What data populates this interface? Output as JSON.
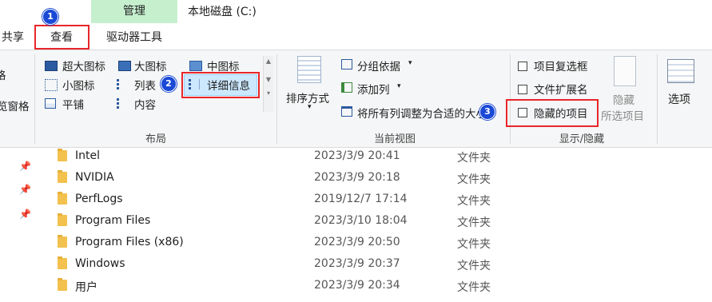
{
  "window": {
    "title": "本地磁盘 (C:)"
  },
  "ribbon": {
    "context_tab": "管理",
    "tabs": {
      "share": "共享",
      "view": "查看",
      "drive_tools": "驱动器工具"
    },
    "badges": {
      "one": "1",
      "two": "2",
      "three": "3"
    },
    "left_clip": {
      "pane1": "格",
      "pane2": "览窗格"
    },
    "layout": {
      "label": "布局",
      "extra_large": "超大图标",
      "large": "大图标",
      "medium": "中图标",
      "small": "小图标",
      "list": "列表",
      "details": "详细信息",
      "tiles": "平铺",
      "content": "内容"
    },
    "current_view": {
      "label": "当前视图",
      "sort_by": "排序方式",
      "group_by": "分组依据",
      "add_column": "添加列",
      "size_all_columns": "将所有列调整为合适的大小"
    },
    "show_hide": {
      "label": "显示/隐藏",
      "item_checkboxes": "项目复选框",
      "file_extensions": "文件扩展名",
      "hidden_items": "隐藏的项目",
      "hide_selected_1": "隐藏",
      "hide_selected_2": "所选项目"
    },
    "options": "选项"
  },
  "files": [
    {
      "name": "Intel",
      "date": "2023/3/9 20:41",
      "type": "文件夹"
    },
    {
      "name": "NVIDIA",
      "date": "2023/3/9 20:18",
      "type": "文件夹"
    },
    {
      "name": "PerfLogs",
      "date": "2019/12/7 17:14",
      "type": "文件夹"
    },
    {
      "name": "Program Files",
      "date": "2023/3/10 18:04",
      "type": "文件夹"
    },
    {
      "name": "Program Files (x86)",
      "date": "2023/3/9 20:50",
      "type": "文件夹"
    },
    {
      "name": "Windows",
      "date": "2023/3/9 20:37",
      "type": "文件夹"
    },
    {
      "name": "用户",
      "date": "2023/3/9 20:34",
      "type": "文件夹"
    }
  ],
  "icons": [
    "pin-icon",
    "folder-icon",
    "view-icon",
    "sort-icon",
    "options-icon"
  ],
  "colors": {
    "context_tab": "#c6efce",
    "highlight": "#cce8ff",
    "annotation_red": "#e8262a",
    "badge_blue": "#1a49d6"
  }
}
